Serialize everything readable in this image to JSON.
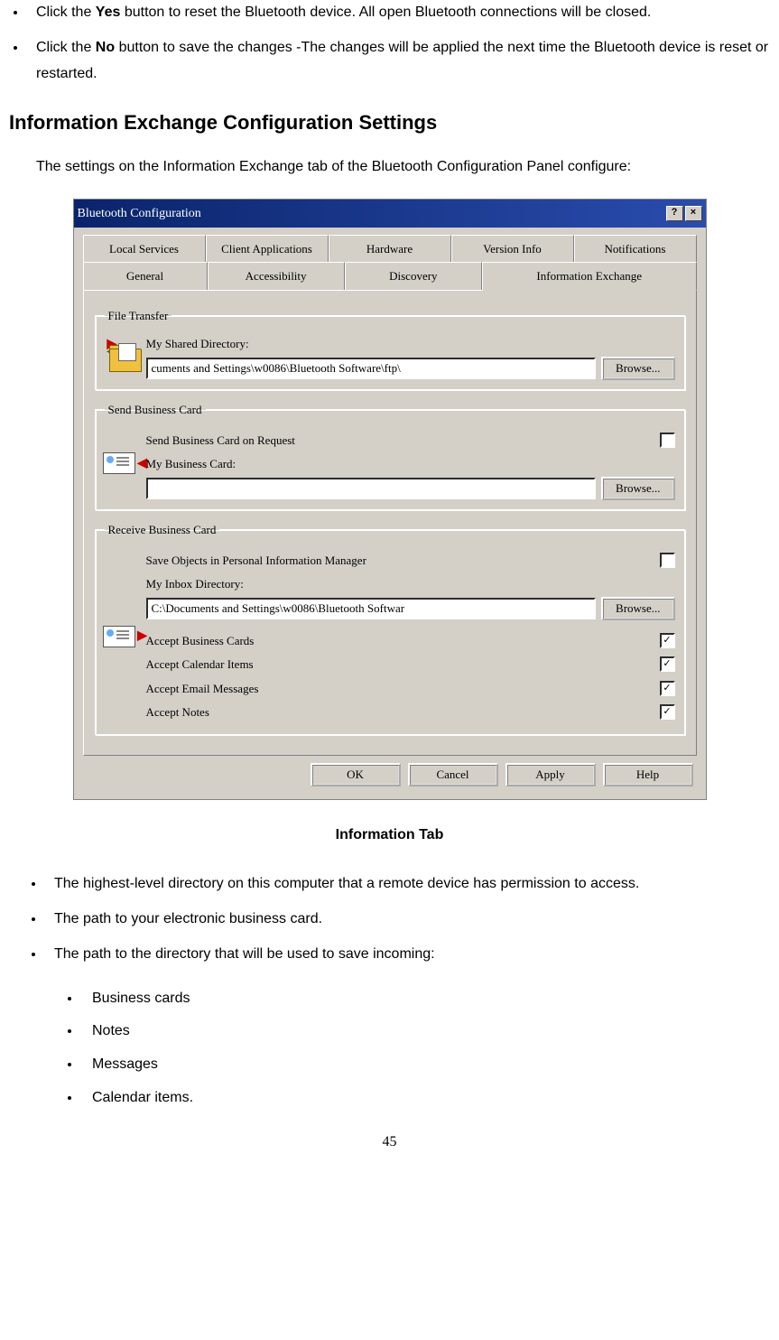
{
  "bullets_top": [
    {
      "pre": "Click the ",
      "bold": "Yes",
      "post": " button to reset the Bluetooth device. All open Bluetooth connections will be closed."
    },
    {
      "pre": "Click the ",
      "bold": "No",
      "post": " button to save the changes -The changes will be applied the next time the Bluetooth device is reset or restarted."
    }
  ],
  "heading": "Information Exchange Configuration Settings",
  "intro": "The settings on the Information Exchange tab of the Bluetooth Configuration Panel configure:",
  "dialog": {
    "title": "Bluetooth Configuration",
    "help_btn": "?",
    "close_btn": "×",
    "tabs_back": [
      "Local Services",
      "Client Applications",
      "Hardware",
      "Version Info",
      "Notifications"
    ],
    "tabs_front": [
      "General",
      "Accessibility",
      "Discovery",
      "Information Exchange"
    ],
    "file_transfer": {
      "legend": "File Transfer",
      "label": "My Shared Directory:",
      "value": "cuments and Settings\\w0086\\Bluetooth Software\\ftp\\",
      "browse": "Browse..."
    },
    "send_card": {
      "legend": "Send Business Card",
      "req_label": "Send Business Card on Request",
      "my_card_label": "My Business Card:",
      "value": "",
      "browse": "Browse..."
    },
    "receive_card": {
      "legend": "Receive Business Card",
      "save_label": "Save Objects in Personal Information Manager",
      "inbox_label": "My Inbox Directory:",
      "value": "C:\\Documents and Settings\\w0086\\Bluetooth Softwar",
      "browse": "Browse...",
      "accepts": [
        {
          "label": "Accept Business Cards",
          "checked": true
        },
        {
          "label": "Accept Calendar Items",
          "checked": true
        },
        {
          "label": "Accept Email Messages",
          "checked": true
        },
        {
          "label": "Accept Notes",
          "checked": true
        }
      ]
    },
    "buttons": [
      "OK",
      "Cancel",
      "Apply",
      "Help"
    ]
  },
  "caption": "Information Tab",
  "bullets_mid": [
    "The highest-level directory on this computer that a remote device has permission to access.",
    "The path to your electronic business card.",
    "The path to the directory that will be used to save incoming:"
  ],
  "bullets_sub": [
    "Business cards",
    "Notes",
    "Messages",
    "Calendar items."
  ],
  "page_number": "45"
}
